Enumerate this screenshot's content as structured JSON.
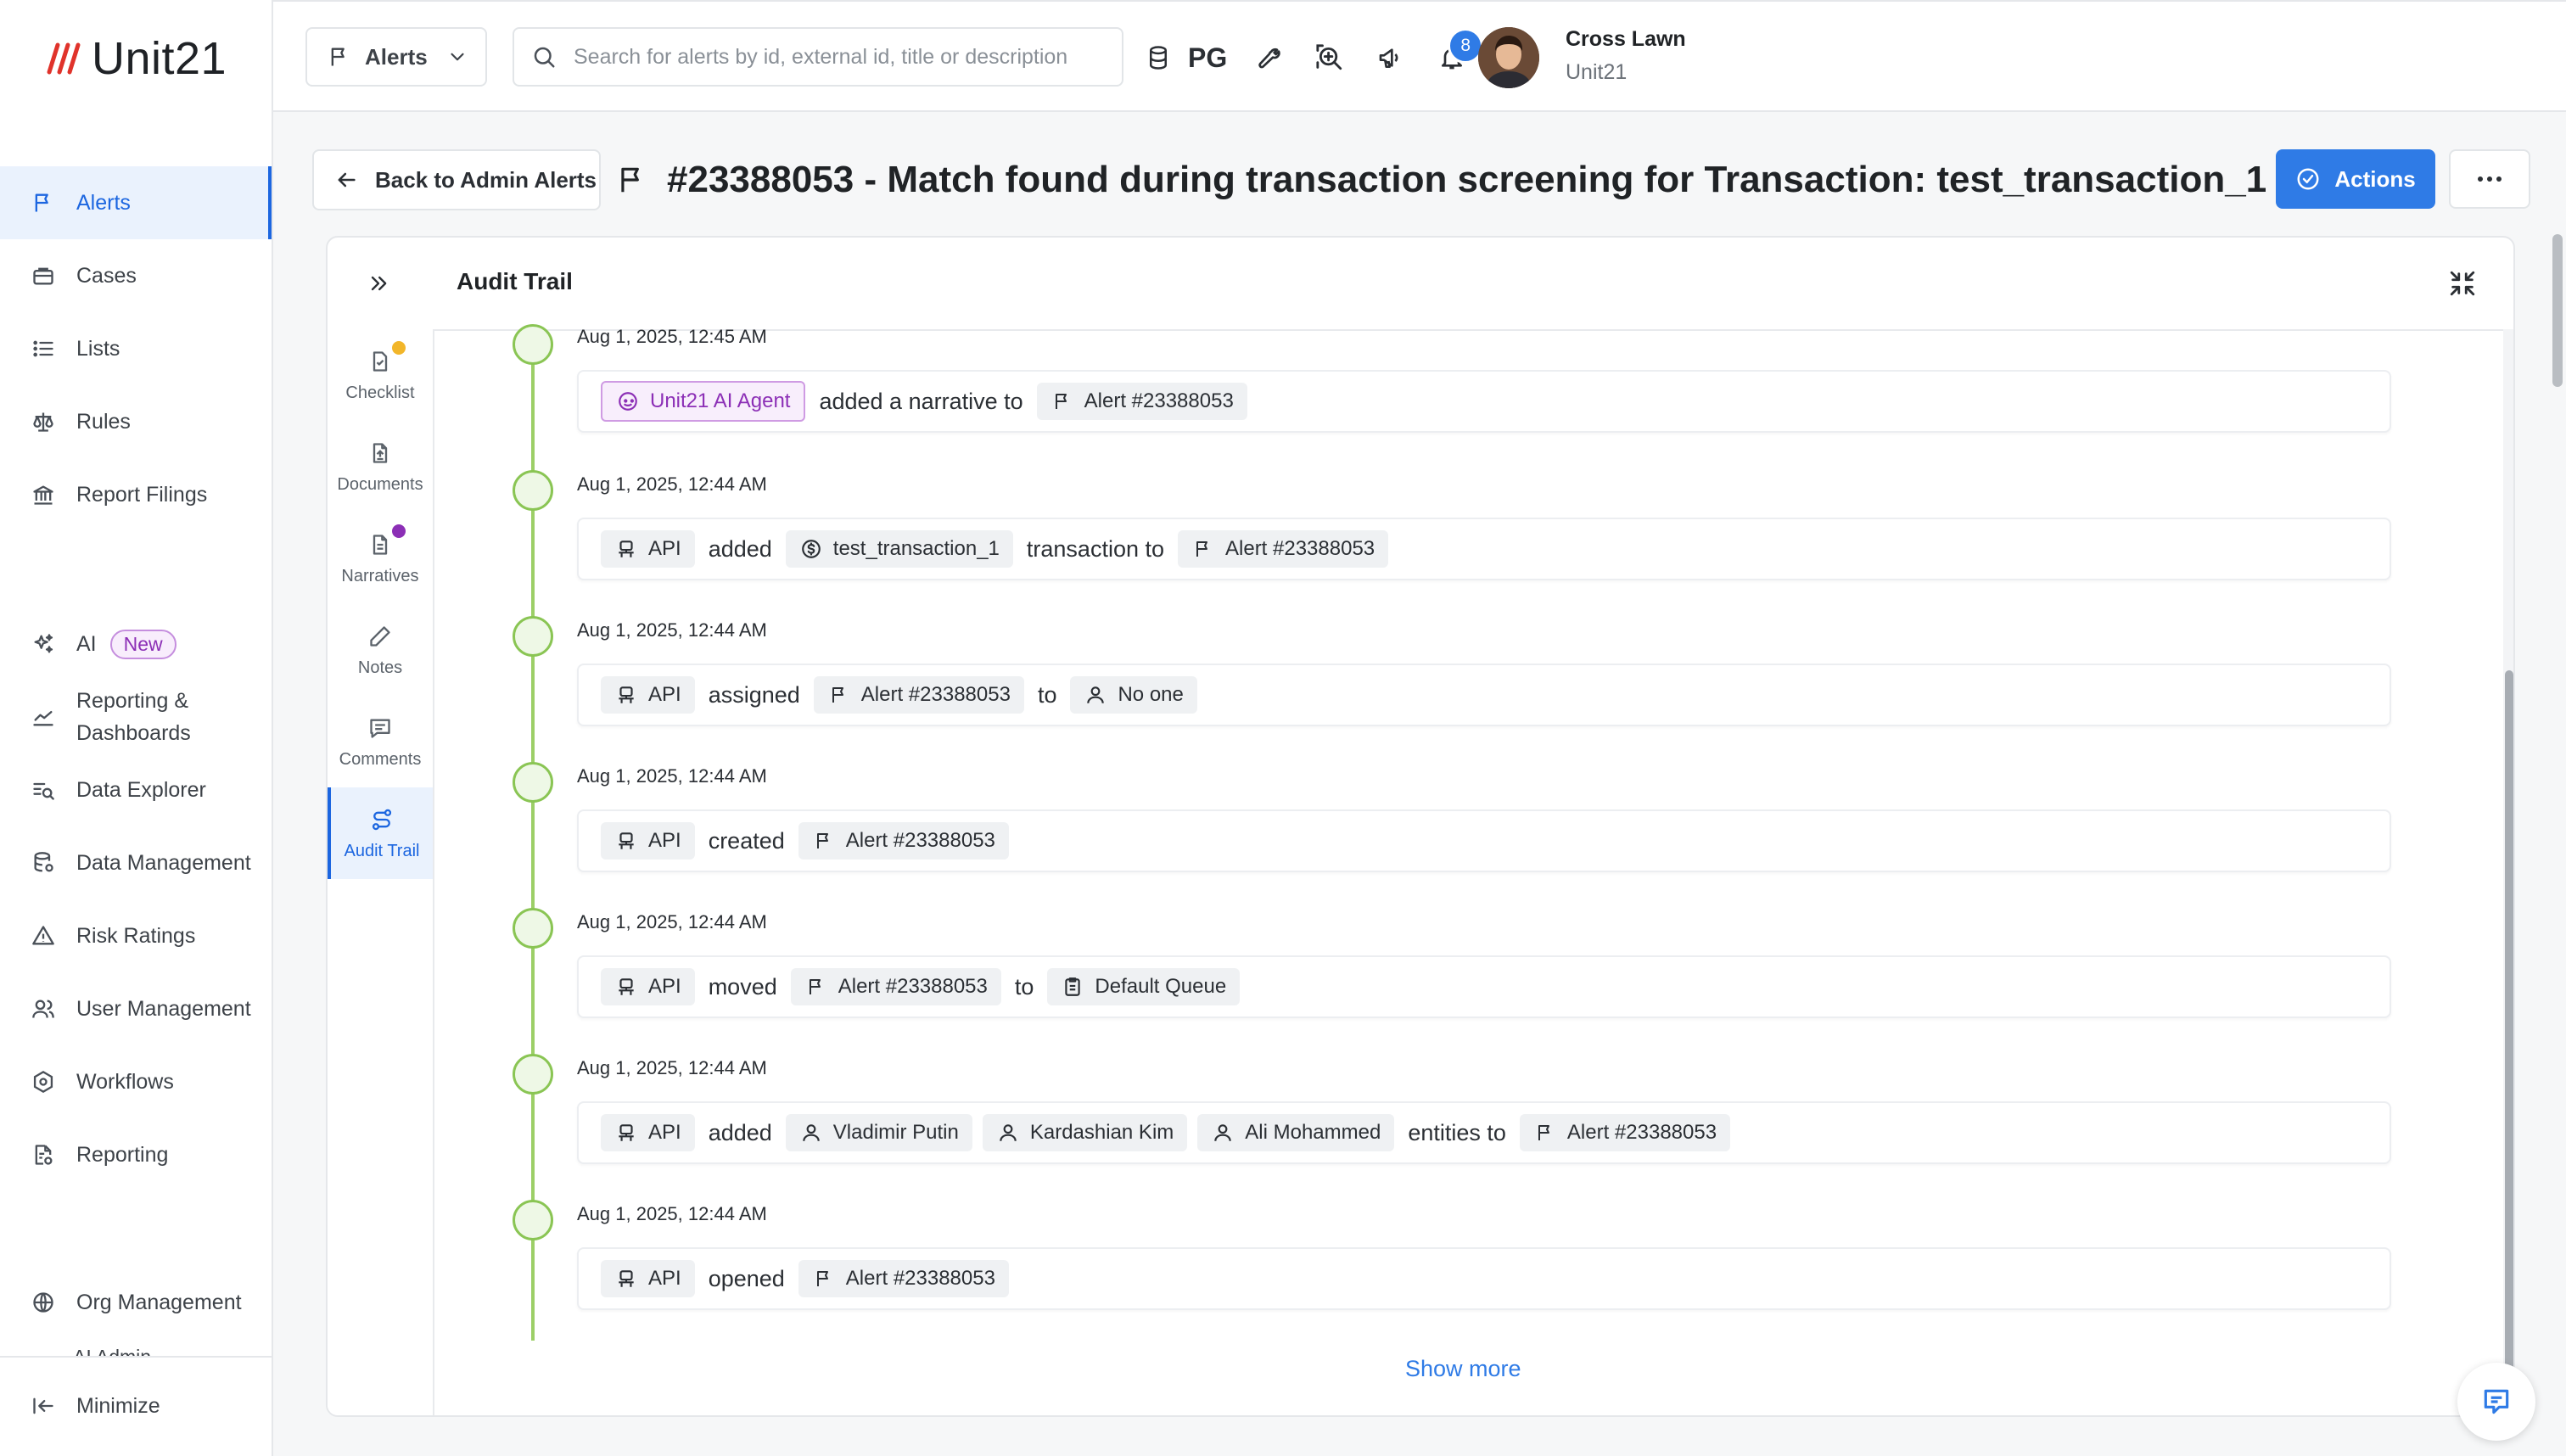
{
  "brand": {
    "logo_text": "Unit21",
    "accent": "#e0332b"
  },
  "topbar": {
    "dropdown_label": "Alerts",
    "search_placeholder": "Search for alerts by id, external id, title or description",
    "pg_label": "PG",
    "notifications_count": "8",
    "user_name": "Cross Lawn",
    "user_org": "Unit21"
  },
  "sidebar": {
    "items": [
      {
        "label": "Alerts",
        "icon": "flag-icon"
      },
      {
        "label": "Cases",
        "icon": "briefcase-icon"
      },
      {
        "label": "Lists",
        "icon": "list-icon"
      },
      {
        "label": "Rules",
        "icon": "scale-icon"
      },
      {
        "label": "Report Filings",
        "icon": "bank-icon"
      },
      {
        "label": "AI",
        "icon": "sparkles-icon",
        "badge": "New"
      },
      {
        "label_line1": "Reporting &",
        "label_line2": "Dashboards",
        "icon": "chart-icon"
      },
      {
        "label": "Data Explorer",
        "icon": "search-list-icon"
      },
      {
        "label": "Data Management",
        "icon": "database-icon"
      },
      {
        "label": "Risk Ratings",
        "icon": "warning-icon"
      },
      {
        "label": "User Management",
        "icon": "users-icon"
      },
      {
        "label": "Workflows",
        "icon": "workflow-icon"
      },
      {
        "label": "Reporting",
        "icon": "report-icon"
      },
      {
        "label": "Org Management",
        "icon": "globe-icon"
      }
    ],
    "clipped_item": "AI Admin",
    "minimize_label": "Minimize"
  },
  "header": {
    "back_label": "Back to Admin Alerts",
    "title": "#23388053 - Match found during transaction screening for Transaction: test_transaction_1",
    "actions_label": "Actions"
  },
  "panel": {
    "title": "Audit Trail",
    "tabs": [
      {
        "label": "Checklist",
        "dot_color": "#f2b62a"
      },
      {
        "label": "Documents"
      },
      {
        "label": "Narratives",
        "dot_color": "#8c2fb6"
      },
      {
        "label": "Notes"
      },
      {
        "label": "Comments"
      },
      {
        "label": "Audit Trail",
        "active": true
      }
    ],
    "show_more": "Show more"
  },
  "events": [
    {
      "timestamp": "Aug 1, 2025, 12:45 AM",
      "actor": "Unit21 AI Agent",
      "verb1": "added a narrative to",
      "alert": "Alert #23388053"
    },
    {
      "timestamp": "Aug 1, 2025, 12:44 AM",
      "actor": "API",
      "verb1": "added",
      "txn": "test_transaction_1",
      "verb2": "transaction to",
      "alert": "Alert #23388053"
    },
    {
      "timestamp": "Aug 1, 2025, 12:44 AM",
      "actor": "API",
      "verb1": "assigned",
      "alert": "Alert #23388053",
      "verb2": "to",
      "assignee": "No one"
    },
    {
      "timestamp": "Aug 1, 2025, 12:44 AM",
      "actor": "API",
      "verb1": "created",
      "alert": "Alert #23388053"
    },
    {
      "timestamp": "Aug 1, 2025, 12:44 AM",
      "actor": "API",
      "verb1": "moved",
      "alert": "Alert #23388053",
      "verb2": "to",
      "queue": "Default Queue"
    },
    {
      "timestamp": "Aug 1, 2025, 12:44 AM",
      "actor": "API",
      "verb1": "added",
      "entities": [
        "Vladimir Putin",
        "Kardashian Kim",
        "Ali Mohammed"
      ],
      "verb2": "entities to",
      "alert": "Alert #23388053"
    },
    {
      "timestamp": "Aug 1, 2025, 12:44 AM",
      "actor": "API",
      "verb1": "opened",
      "alert": "Alert #23388053"
    }
  ]
}
